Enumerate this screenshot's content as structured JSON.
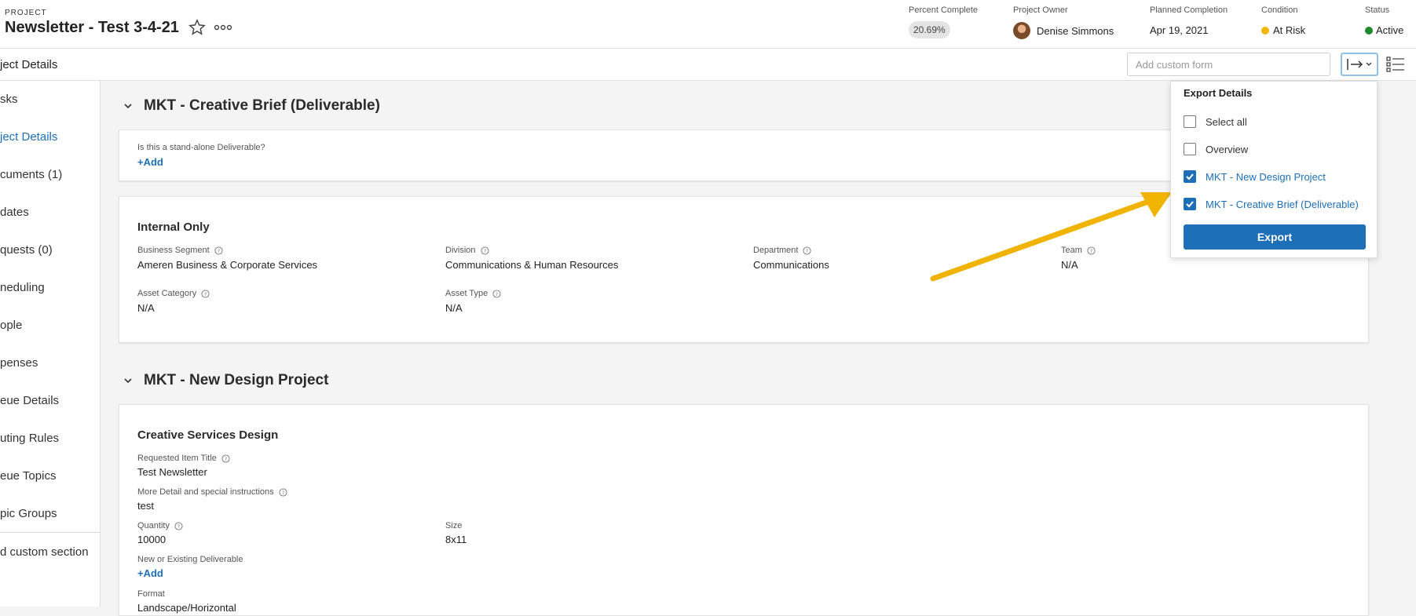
{
  "header": {
    "project_label": "PROJECT",
    "title": "Newsletter - Test 3-4-21",
    "percent_complete": {
      "label": "Percent Complete",
      "value": "20.69%"
    },
    "project_owner": {
      "label": "Project Owner",
      "value": "Denise Simmons"
    },
    "planned_completion": {
      "label": "Planned Completion",
      "value": "Apr 19, 2021"
    },
    "condition": {
      "label": "Condition",
      "value": "At Risk",
      "color": "#f2b705"
    },
    "status": {
      "label": "Status",
      "value": "Active",
      "color": "#1e8a2e"
    }
  },
  "subbar": {
    "page_title": "ject Details",
    "custom_form_placeholder": "Add custom form"
  },
  "sidebar": {
    "items": [
      {
        "label": "sks"
      },
      {
        "label": "ject Details"
      },
      {
        "label": "cuments (1)"
      },
      {
        "label": "dates"
      },
      {
        "label": "quests (0)"
      },
      {
        "label": "neduling"
      },
      {
        "label": "ople"
      },
      {
        "label": "penses"
      },
      {
        "label": "eue Details"
      },
      {
        "label": "uting Rules"
      },
      {
        "label": "eue Topics"
      },
      {
        "label": "pic Groups"
      },
      {
        "label": "d custom section"
      }
    ]
  },
  "sections": {
    "creative_brief": {
      "title": "MKT - Creative Brief (Deliverable)",
      "standalone_label": "Is this a stand-alone Deliverable?",
      "add_label": "+Add"
    },
    "internal_only": {
      "title": "Internal Only",
      "fields": [
        {
          "label": "Business Segment",
          "value": "Ameren Business & Corporate Services"
        },
        {
          "label": "Division",
          "value": "Communications & Human Resources"
        },
        {
          "label": "Department",
          "value": "Communications"
        },
        {
          "label": "Team",
          "value": "N/A"
        },
        {
          "label": "Asset Category",
          "value": "N/A"
        },
        {
          "label": "Asset Type",
          "value": "N/A"
        }
      ]
    },
    "new_design": {
      "title": "MKT - New Design Project",
      "card_title": "Creative Services Design",
      "requested_title": {
        "label": "Requested Item Title",
        "value": "Test Newsletter"
      },
      "more_detail": {
        "label": "More Detail and special instructions",
        "value": "test"
      },
      "quantity": {
        "label": "Quantity",
        "value": "10000"
      },
      "size": {
        "label": "Size",
        "value": "8x11"
      },
      "new_existing": {
        "label": "New or Existing Deliverable",
        "value": "+Add"
      },
      "format": {
        "label": "Format",
        "value": "Landscape/Horizontal"
      }
    }
  },
  "export_menu": {
    "title": "Export Details",
    "options": [
      {
        "label": "Select all",
        "checked": false
      },
      {
        "label": "Overview",
        "checked": false
      },
      {
        "label": "MKT - New Design Project",
        "checked": true
      },
      {
        "label": "MKT - Creative Brief (Deliverable)",
        "checked": true
      }
    ],
    "export_label": "Export"
  },
  "colors": {
    "accent": "#1d6fb8",
    "arrow": "#f0b400"
  }
}
